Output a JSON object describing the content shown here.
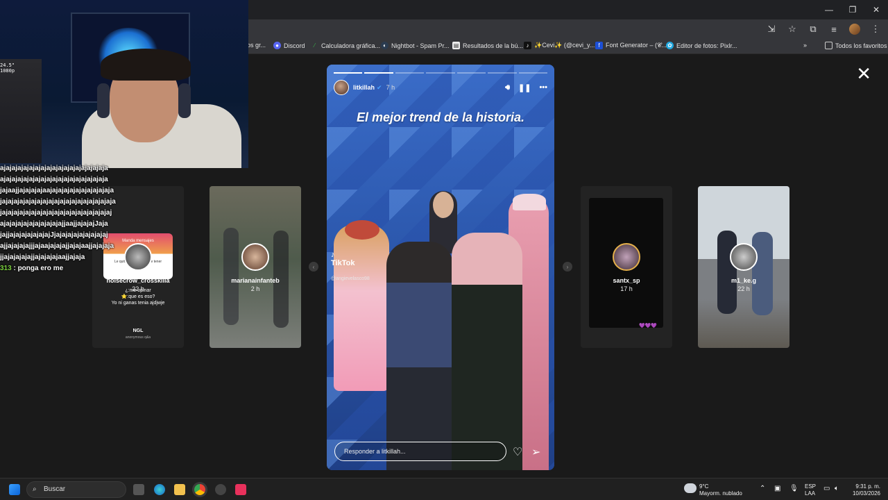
{
  "browser": {
    "bookmarks": [
      {
        "label": "os gr...",
        "icon": "bookmark-icon"
      },
      {
        "label": "Discord",
        "icon": "discord-icon"
      },
      {
        "label": "Calculadora gráfica...",
        "icon": "calculator-icon"
      },
      {
        "label": "Nightbot - Spam Pr...",
        "icon": "nightbot-icon"
      },
      {
        "label": "Resultados de la bú...",
        "icon": "search-results-icon"
      },
      {
        "label": "✨Cevi✨ (@cevi_y...",
        "icon": "tiktok-icon"
      },
      {
        "label": "Font Generator – (𝓒...",
        "icon": "font-generator-icon"
      },
      {
        "label": "Editor de fotos: Pixlr...",
        "icon": "pixlr-icon"
      }
    ],
    "all_bookmarks_label": "Todos los favoritos"
  },
  "stories": {
    "left_cards": [
      {
        "username": "noisecrow_crosskilla",
        "time": "22 h"
      },
      {
        "username": "marianainfanteb",
        "time": "2 h"
      }
    ],
    "right_cards": [
      {
        "username": "santx_sp",
        "time": "17 h"
      },
      {
        "username": "m1_ke.g",
        "time": "22 h"
      }
    ],
    "ngl_card": {
      "title": "Manda mensajes",
      "body": "Le quitas a tu nombre de tener",
      "q1": "¿:me opinar",
      "q2": "⭐:que es eso?",
      "q3": "Yo ni ganas tenia ajdjwje",
      "brand": "NGL",
      "brand_sub": "anonymous q&a"
    },
    "active": {
      "username": "litkillah",
      "time": "7 h",
      "title": "El mejor trend de la historia.",
      "tiktok_label": "TikTok",
      "tiktok_handle": "@angievelasco98",
      "reply_placeholder": "Responder a litkillah...",
      "progress_total": 7,
      "progress_done": 2
    }
  },
  "chat": {
    "lines": [
      "ajajajajajajajajajajajajajajajajajaja",
      "ajajajajajajajajajajajajajajajajajaja",
      "jajaajjajajajajaajajajajajajajajajajaja",
      "jajajajajajajajajajajajajajajajajajajaja",
      "jajajajajajajajajajajajajajajajajajajaj",
      "ajajajajajajajajajajajjaajjajajajJaja",
      "jajjajajajajajajajJjajajajajajajajajaj",
      "ajjajajajajjjajaajajajajjajajaajjajajaja",
      "jjajajajajajjajajajajaajjajaja"
    ],
    "user_line": {
      "user": "313",
      "message": " : ponga ero me"
    }
  },
  "taskbar": {
    "search_label": "Buscar",
    "weather_temp": "9°C",
    "weather_desc": "Mayorm. nublado",
    "lang": "ESP",
    "region": "LAA",
    "time": "9:31 p. m.",
    "date": "10/03/2026"
  }
}
